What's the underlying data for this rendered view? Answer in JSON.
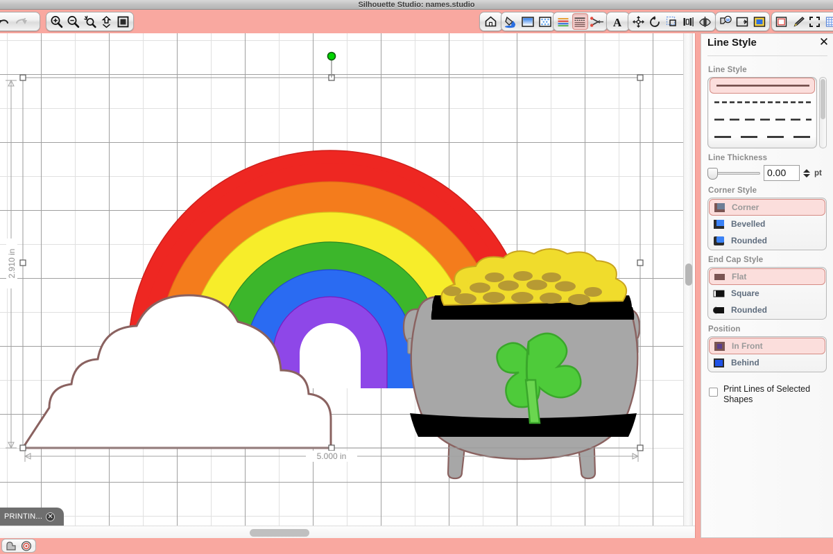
{
  "window": {
    "title": "Silhouette Studio: names.studio"
  },
  "toolbar": {
    "groups": [
      {
        "name": "history",
        "buttons": [
          {
            "name": "undo-icon",
            "label": "Undo"
          },
          {
            "name": "redo-icon",
            "label": "Redo"
          }
        ]
      },
      {
        "name": "zoom",
        "buttons": [
          {
            "name": "zoom-in-icon",
            "label": "Zoom In"
          },
          {
            "name": "zoom-out-icon",
            "label": "Zoom Out"
          },
          {
            "name": "zoom-selection-icon",
            "label": "Zoom to Selection"
          },
          {
            "name": "fit-to-page-icon",
            "label": "Fit To Page"
          },
          {
            "name": "fit-to-window-icon",
            "label": "Fit To Window"
          }
        ]
      },
      {
        "name": "home",
        "buttons": [
          {
            "name": "home-icon",
            "label": "Home"
          }
        ]
      },
      {
        "name": "design",
        "buttons": [
          {
            "name": "fill-color-icon",
            "label": "Fill Color"
          },
          {
            "name": "gradient-fill-icon",
            "label": "Gradient Fill"
          },
          {
            "name": "pattern-fill-icon",
            "label": "Pattern Fill"
          }
        ]
      },
      {
        "name": "line",
        "buttons": [
          {
            "name": "line-color-icon",
            "label": "Line Color"
          },
          {
            "name": "line-style-icon",
            "label": "Line Style",
            "selected": true
          },
          {
            "name": "cut-style-icon",
            "label": "Cut Style"
          }
        ]
      },
      {
        "name": "text",
        "buttons": [
          {
            "name": "text-style-icon",
            "label": "Text Style"
          }
        ]
      },
      {
        "name": "transform",
        "buttons": [
          {
            "name": "move-icon",
            "label": "Move"
          },
          {
            "name": "rotate-icon",
            "label": "Rotate"
          },
          {
            "name": "scale-icon",
            "label": "Scale"
          },
          {
            "name": "align-icon",
            "label": "Align"
          },
          {
            "name": "replicate-icon",
            "label": "Replicate"
          }
        ]
      },
      {
        "name": "modify",
        "buttons": [
          {
            "name": "modify-icon",
            "label": "Modify"
          },
          {
            "name": "offset-icon",
            "label": "Offset"
          },
          {
            "name": "trace-icon",
            "label": "Trace"
          }
        ]
      },
      {
        "name": "page",
        "buttons": [
          {
            "name": "page-setup-icon",
            "label": "Page Setup"
          },
          {
            "name": "pen-tool-icon",
            "label": "Pen Tool"
          },
          {
            "name": "registration-marks-icon",
            "label": "Registration Marks"
          },
          {
            "name": "cut-settings-icon",
            "label": "Cut Settings"
          }
        ]
      }
    ]
  },
  "canvas": {
    "dimensions": {
      "width_label": "5.000 in",
      "height_label": "2.910 in"
    },
    "selection": {
      "rotate_handle": "rotation-handle",
      "handles": 8
    },
    "artwork": {
      "name": "rainbow-pot-of-gold",
      "rainbow_colors": [
        "#ee2722",
        "#f47c1c",
        "#f7ed2a",
        "#3cb62b",
        "#2a6bf2",
        "#8e47e8"
      ],
      "cloud_color": "#ffffff",
      "cloud_outline": "#8a6260",
      "pot_color": "#a7a7a7",
      "pot_band_color": "#000000",
      "gold_color": "#f0dc2c",
      "gold_shade": "#b79a33",
      "clover_color": "#4ecb3a"
    }
  },
  "statusTab": {
    "label": "PRINTIN...",
    "close": "✕"
  },
  "panel": {
    "title": "Line Style",
    "close_label": "✕",
    "sections": {
      "line_style": {
        "label": "Line Style",
        "options": [
          {
            "name": "solid",
            "selected": true
          },
          {
            "name": "fine-dash",
            "selected": false
          },
          {
            "name": "medium-dash",
            "selected": false
          },
          {
            "name": "long-dash",
            "selected": false
          }
        ]
      },
      "line_thickness": {
        "label": "Line Thickness",
        "value": "0.00",
        "unit": "pt",
        "slider_position": 0
      },
      "corner_style": {
        "label": "Corner Style",
        "options": [
          {
            "label": "Corner",
            "selected": true
          },
          {
            "label": "Bevelled",
            "selected": false
          },
          {
            "label": "Rounded",
            "selected": false
          }
        ]
      },
      "end_cap_style": {
        "label": "End Cap Style",
        "options": [
          {
            "label": "Flat",
            "selected": true
          },
          {
            "label": "Square",
            "selected": false
          },
          {
            "label": "Rounded",
            "selected": false
          }
        ]
      },
      "position": {
        "label": "Position",
        "options": [
          {
            "label": "In Front",
            "selected": true
          },
          {
            "label": "Behind",
            "selected": false
          }
        ]
      },
      "print_lines": {
        "label": "Print Lines of Selected Shapes",
        "checked": false
      }
    }
  },
  "footer": {
    "buttons": [
      {
        "name": "cursor-icon",
        "label": "Select Tool"
      },
      {
        "name": "registration-target-icon",
        "label": "Registration"
      }
    ]
  },
  "colors": {
    "chrome": "#f9a8a0",
    "accent": "#d58b84",
    "selected_bg": "#fbdedc"
  }
}
